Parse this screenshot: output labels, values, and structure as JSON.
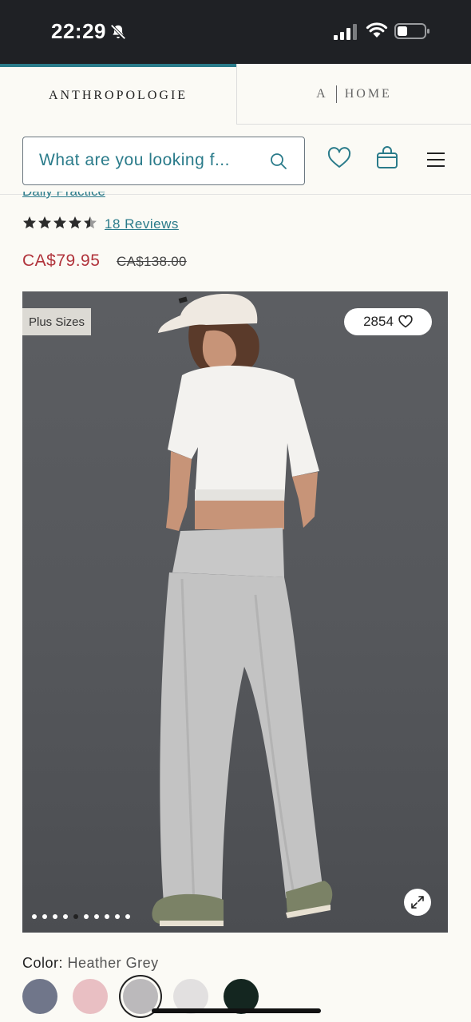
{
  "status_bar": {
    "time": "22:29",
    "icons": [
      "bell-muted-icon",
      "cellular-signal-icon",
      "wifi-icon",
      "battery-icon"
    ]
  },
  "brand_tabs": {
    "primary": "ANTHROPOLOGIE",
    "home_prefix": "A",
    "home_label": "HOME",
    "accent_color": "#2a7b8a"
  },
  "search": {
    "placeholder": "What are you looking f..."
  },
  "nav_icons": [
    "heart-icon",
    "shopping-bag-icon",
    "hamburger-menu-icon"
  ],
  "product": {
    "brand": "Daily Practice",
    "rating": 4.5,
    "rating_max": 5,
    "reviews_label": "18 Reviews",
    "sale_price": "CA$79.95",
    "original_price": "CA$138.00",
    "sale_color": "#b0333b"
  },
  "gallery": {
    "badge": "Plus Sizes",
    "favorites_count": "2854",
    "image_count": 10,
    "active_index": 4
  },
  "color": {
    "label": "Color:",
    "selected": "Heather Grey",
    "swatches": [
      {
        "name": "slate-blue",
        "hex": "#70768a"
      },
      {
        "name": "pink",
        "hex": "#e9bfc3"
      },
      {
        "name": "heather-grey",
        "hex": "#bbb9bb",
        "selected": true
      },
      {
        "name": "light-grey",
        "hex": "#e2e0e0"
      },
      {
        "name": "dark-green",
        "hex": "#142620"
      }
    ]
  }
}
